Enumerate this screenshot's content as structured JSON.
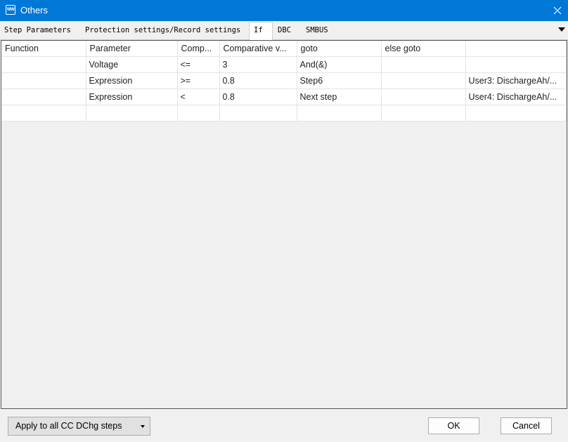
{
  "window": {
    "title": "Others",
    "icon_text": "WW",
    "icon": "app-icon",
    "close_icon": "close-icon"
  },
  "tabs": [
    {
      "label": "Step Parameters",
      "active": false
    },
    {
      "label": "Protection settings/Record settings",
      "active": false
    },
    {
      "label": "If",
      "active": true
    },
    {
      "label": "DBC",
      "active": false
    },
    {
      "label": "SMBUS",
      "active": false
    }
  ],
  "table": {
    "columns": [
      "Function",
      "Parameter",
      "Comp...",
      "Comparative v...",
      "goto",
      "else goto",
      ""
    ],
    "rows": [
      [
        "",
        "Voltage",
        "<=",
        "3",
        "And(&)",
        "",
        ""
      ],
      [
        "",
        "Expression",
        ">=",
        "0.8",
        "Step6",
        "",
        "User3: DischargeAh/..."
      ],
      [
        "",
        "Expression",
        "<",
        "0.8",
        "Next step",
        "",
        "User4: DischargeAh/..."
      ],
      [
        "",
        "",
        "",
        "",
        "",
        "",
        ""
      ]
    ]
  },
  "footer": {
    "apply_label": "Apply to all CC DChg steps",
    "ok_label": "OK",
    "cancel_label": "Cancel"
  },
  "colors": {
    "titlebar": "#0078d7",
    "background": "#f0f0f0"
  }
}
